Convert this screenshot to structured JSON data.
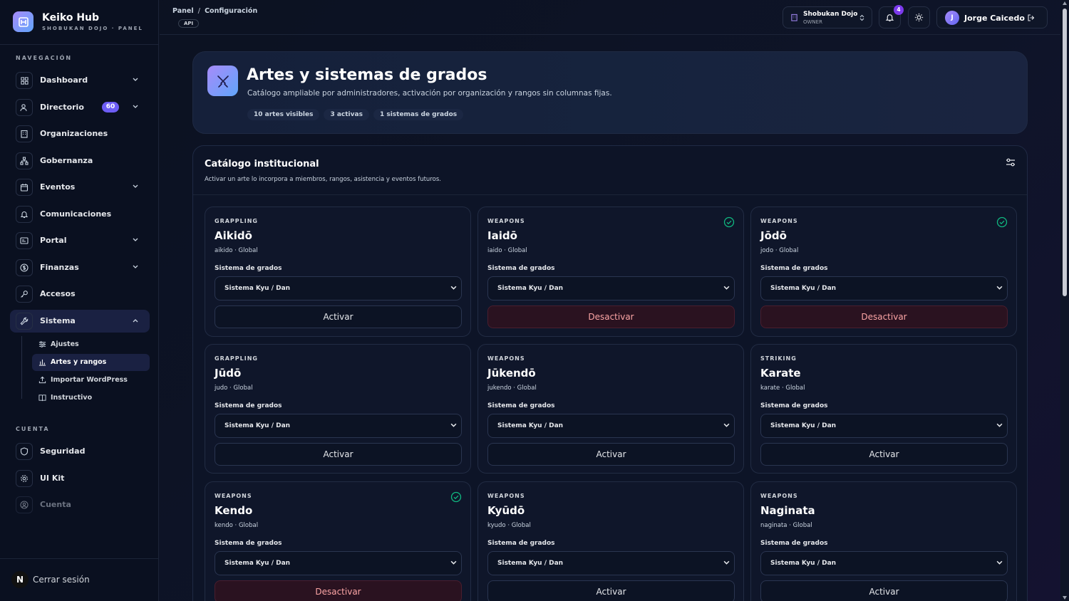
{
  "brand": {
    "name": "Keiko Hub",
    "subtitle": "SHOBUKAN DOJO · PANEL"
  },
  "sidebar": {
    "nav_label": "NAVEGACIÓN",
    "account_label": "CUENTA",
    "items": [
      {
        "label": "Dashboard",
        "icon": "grid-icon"
      },
      {
        "label": "Directorio",
        "icon": "users-icon",
        "badge": "60"
      },
      {
        "label": "Organizaciones",
        "icon": "building-icon"
      },
      {
        "label": "Gobernanza",
        "icon": "network-icon"
      },
      {
        "label": "Eventos",
        "icon": "calendar-icon"
      },
      {
        "label": "Comunicaciones",
        "icon": "bell-icon"
      },
      {
        "label": "Portal",
        "icon": "browser-icon"
      },
      {
        "label": "Finanzas",
        "icon": "dollar-icon"
      },
      {
        "label": "Accesos",
        "icon": "key-icon"
      },
      {
        "label": "Sistema",
        "icon": "wrench-icon"
      }
    ],
    "sub_items": [
      {
        "label": "Ajustes",
        "icon": "sliders-icon"
      },
      {
        "label": "Artes y rangos",
        "icon": "bar-chart-icon"
      },
      {
        "label": "Importar WordPress",
        "icon": "upload-icon"
      },
      {
        "label": "Instructivo",
        "icon": "book-icon"
      }
    ],
    "account_items": [
      {
        "label": "Seguridad",
        "icon": "shield-icon"
      },
      {
        "label": "UI Kit",
        "icon": "gear-icon"
      },
      {
        "label": "Cuenta",
        "icon": "user-circle-icon"
      }
    ],
    "logout": {
      "avatar": "N",
      "label": "Cerrar sesión"
    }
  },
  "topbar": {
    "breadcrumb": [
      "Panel",
      "Configuración"
    ],
    "tag": "API",
    "org": {
      "name": "Shobukan Dojo",
      "role": "OWNER"
    },
    "notifications": "4",
    "user": {
      "initial": "J",
      "name": "Jorge Caicedo"
    }
  },
  "hero": {
    "title": "Artes y sistemas de grados",
    "description": "Catálogo ampliable por administradores, activación por organización y rangos sin columnas fijas.",
    "stats": [
      "10 artes visibles",
      "3 activas",
      "1 sistemas de grados"
    ]
  },
  "catalog": {
    "title": "Catálogo institucional",
    "description": "Activar un arte lo incorpora a miembros, rangos, asistencia y eventos futuros.",
    "grade_label": "Sistema de grados",
    "cards": [
      {
        "category": "GRAPPLING",
        "name": "Aikidō",
        "slug": "aikido · Global",
        "grade": "Sistema Kyu / Dan",
        "active": false,
        "action": "Activar"
      },
      {
        "category": "WEAPONS",
        "name": "Iaidō",
        "slug": "iaido · Global",
        "grade": "Sistema Kyu / Dan",
        "active": true,
        "action": "Desactivar"
      },
      {
        "category": "WEAPONS",
        "name": "Jōdō",
        "slug": "jodo · Global",
        "grade": "Sistema Kyu / Dan",
        "active": true,
        "action": "Desactivar"
      },
      {
        "category": "GRAPPLING",
        "name": "Jūdō",
        "slug": "judo · Global",
        "grade": "Sistema Kyu / Dan",
        "active": false,
        "action": "Activar"
      },
      {
        "category": "WEAPONS",
        "name": "Jūkendō",
        "slug": "jukendo · Global",
        "grade": "Sistema Kyu / Dan",
        "active": false,
        "action": "Activar"
      },
      {
        "category": "STRIKING",
        "name": "Karate",
        "slug": "karate · Global",
        "grade": "Sistema Kyu / Dan",
        "active": false,
        "action": "Activar"
      },
      {
        "category": "WEAPONS",
        "name": "Kendo",
        "slug": "kendo · Global",
        "grade": "Sistema Kyu / Dan",
        "active": true,
        "action": "Desactivar"
      },
      {
        "category": "WEAPONS",
        "name": "Kyūdō",
        "slug": "kyudo · Global",
        "grade": "Sistema Kyu / Dan",
        "active": false,
        "action": "Activar"
      },
      {
        "category": "WEAPONS",
        "name": "Naginata",
        "slug": "naginata · Global",
        "grade": "Sistema Kyu / Dan",
        "active": false,
        "action": "Activar"
      }
    ]
  },
  "colors": {
    "accent": "#6d5df5",
    "success": "#10b981",
    "danger": "#fca5a5"
  }
}
